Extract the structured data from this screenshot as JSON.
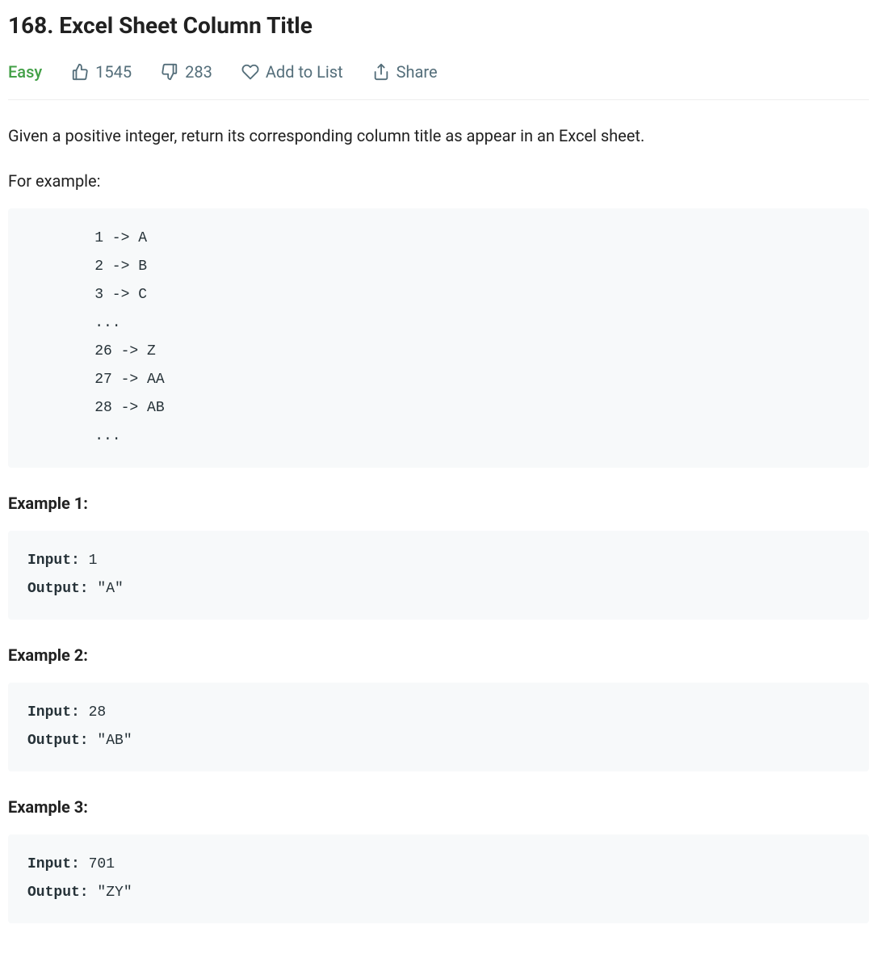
{
  "title": "168. Excel Sheet Column Title",
  "difficulty": "Easy",
  "likes": "1545",
  "dislikes": "283",
  "add_to_list": "Add to List",
  "share": "Share",
  "description": "Given a positive integer, return its corresponding column title as appear in an Excel sheet.",
  "for_example": "For example:",
  "mapping": "    1 -> A\n    2 -> B\n    3 -> C\n    ...\n    26 -> Z\n    27 -> AA\n    28 -> AB \n    ...",
  "examples": [
    {
      "heading": "Example 1:",
      "input_label": "Input:",
      "input_value": " 1",
      "output_label": "Output:",
      "output_value": " \"A\""
    },
    {
      "heading": "Example 2:",
      "input_label": "Input:",
      "input_value": " 28",
      "output_label": "Output:",
      "output_value": " \"AB\""
    },
    {
      "heading": "Example 3:",
      "input_label": "Input:",
      "input_value": " 701",
      "output_label": "Output:",
      "output_value": " \"ZY\""
    }
  ]
}
